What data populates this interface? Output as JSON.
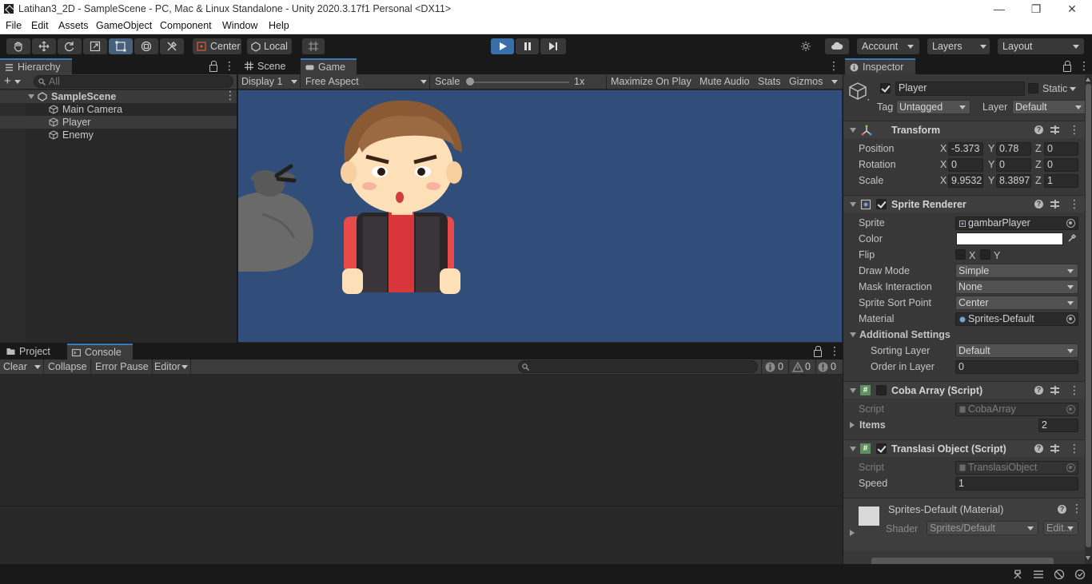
{
  "window": {
    "title": "Latihan3_2D - SampleScene - PC, Mac & Linux Standalone - Unity 2020.3.17f1 Personal <DX11>",
    "minimize": "—",
    "maximize": "❐",
    "close": "✕"
  },
  "menu": [
    "File",
    "Edit",
    "Assets",
    "GameObject",
    "Component",
    "Window",
    "Help"
  ],
  "toolbar": {
    "pivot": "Center",
    "space": "Local",
    "account": "Account",
    "layers": "Layers",
    "layout": "Layout"
  },
  "hierarchy": {
    "tab": "Hierarchy",
    "search_placeholder": "All",
    "scene": "SampleScene",
    "items": [
      "Main Camera",
      "Player",
      "Enemy"
    ]
  },
  "game": {
    "tabs": [
      "Scene",
      "Game"
    ],
    "display": "Display 1",
    "aspect": "Free Aspect",
    "scale_label": "Scale",
    "scale_value": "1x",
    "maximize": "Maximize On Play",
    "mute": "Mute Audio",
    "stats": "Stats",
    "gizmos": "Gizmos"
  },
  "console": {
    "tabs": [
      "Project",
      "Console"
    ],
    "clear": "Clear",
    "collapse": "Collapse",
    "error_pause": "Error Pause",
    "editor": "Editor",
    "info_count": "0",
    "warn_count": "0",
    "error_count": "0"
  },
  "inspector": {
    "tab": "Inspector",
    "object_name": "Player",
    "static_label": "Static",
    "tag_label": "Tag",
    "tag_value": "Untagged",
    "layer_label": "Layer",
    "layer_value": "Default",
    "transform": {
      "title": "Transform",
      "position_label": "Position",
      "rotation_label": "Rotation",
      "scale_label": "Scale",
      "position": {
        "x": "-5.373",
        "y": "0.78",
        "z": "0"
      },
      "rotation": {
        "x": "0",
        "y": "0",
        "z": "0"
      },
      "scale": {
        "x": "9.9532",
        "y": "8.3897",
        "z": "1"
      }
    },
    "sprite_renderer": {
      "title": "Sprite Renderer",
      "sprite_label": "Sprite",
      "sprite_value": "gambarPlayer",
      "color_label": "Color",
      "color_value": "#ffffff",
      "flip_label": "Flip",
      "flip_x": "X",
      "flip_y": "Y",
      "draw_mode_label": "Draw Mode",
      "draw_mode_value": "Simple",
      "mask_label": "Mask Interaction",
      "mask_value": "None",
      "sort_point_label": "Sprite Sort Point",
      "sort_point_value": "Center",
      "material_label": "Material",
      "material_value": "Sprites-Default",
      "additional": "Additional Settings",
      "sorting_layer_label": "Sorting Layer",
      "sorting_layer_value": "Default",
      "order_label": "Order in Layer",
      "order_value": "0"
    },
    "coba_array": {
      "title": "Coba Array (Script)",
      "script_label": "Script",
      "script_value": "CobaArray",
      "items_label": "Items",
      "items_value": "2"
    },
    "translasi": {
      "title": "Translasi Object (Script)",
      "script_label": "Script",
      "script_value": "TranslasiObject",
      "speed_label": "Speed",
      "speed_value": "1"
    },
    "material": {
      "title": "Sprites-Default (Material)",
      "shader_label": "Shader",
      "shader_value": "Sprites/Default",
      "edit": "Edit..."
    }
  }
}
